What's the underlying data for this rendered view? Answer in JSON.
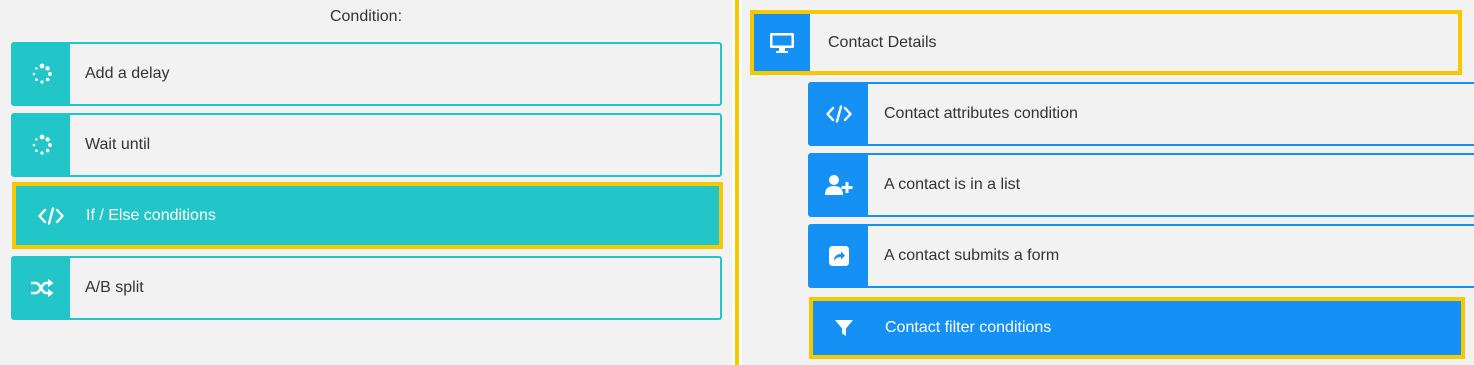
{
  "left_panel": {
    "title": "Condition:",
    "items": [
      {
        "label": "Add a delay",
        "icon": "spinner-icon"
      },
      {
        "label": "Wait until",
        "icon": "spinner-icon"
      },
      {
        "label": "If / Else conditions",
        "icon": "code-icon",
        "selected": true
      },
      {
        "label": "A/B split",
        "icon": "random-icon"
      }
    ]
  },
  "right_panel": {
    "header": {
      "label": "Contact Details",
      "icon": "desktop-icon",
      "selected": true
    },
    "items": [
      {
        "label": "Contact attributes condition",
        "icon": "code-icon"
      },
      {
        "label": "A contact is in a list",
        "icon": "user-plus-icon"
      },
      {
        "label": "A contact submits a form",
        "icon": "share-square-icon"
      },
      {
        "label": "Contact filter conditions",
        "icon": "filter-icon",
        "selected": true
      }
    ]
  },
  "colors": {
    "teal": "#23c6c8",
    "blue": "#1591f5",
    "highlight": "#f5c800",
    "background": "#f2f2f2"
  }
}
